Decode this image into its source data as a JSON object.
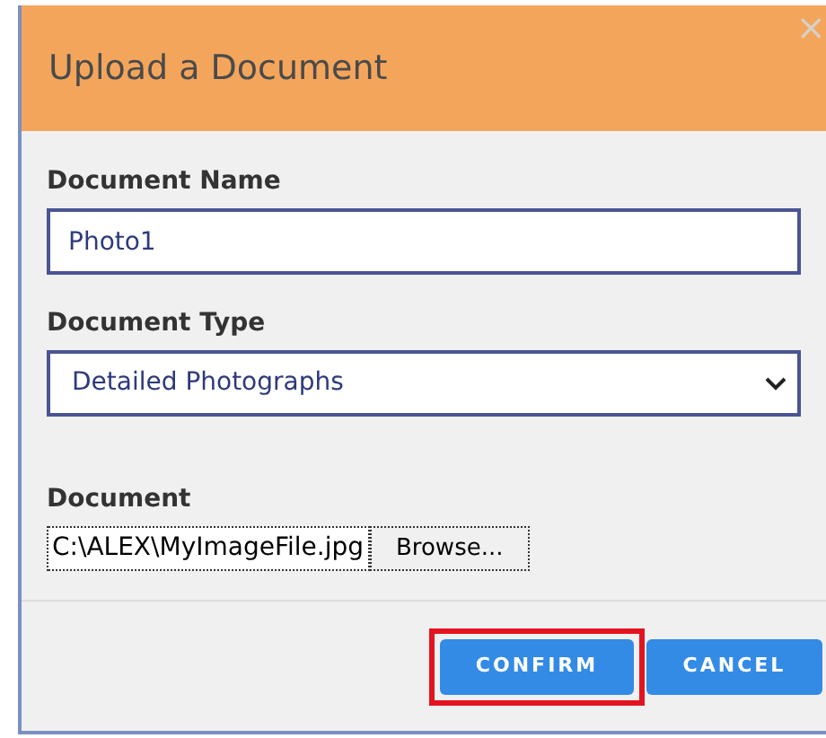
{
  "dialog": {
    "title": "Upload a Document",
    "close": "×"
  },
  "fields": [
    {
      "kind": "text",
      "label": "Document Name",
      "value": "Photo1"
    },
    {
      "kind": "select",
      "label": "Document Type",
      "value": "Detailed Photographs"
    },
    {
      "kind": "file",
      "label": "Document",
      "value": "C:\\ALEX\\MyImageFile.jpg",
      "button": "Browse..."
    }
  ],
  "buttons": [
    {
      "label": "CONFIRM",
      "highlighted": true
    },
    {
      "label": "CANCEL",
      "highlighted": false
    }
  ]
}
